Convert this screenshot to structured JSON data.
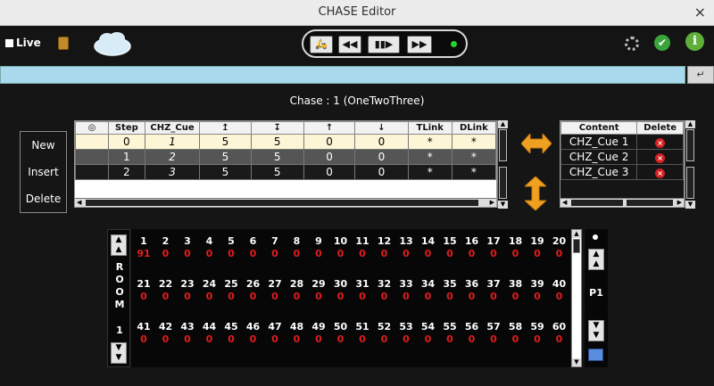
{
  "window": {
    "title": "CHASE Editor",
    "close_glyph": "×"
  },
  "toolbar": {
    "live_label": "Live",
    "transport": [
      {
        "name": "chase-mode-button",
        "glyph": "🛵"
      },
      {
        "name": "rewind-button",
        "glyph": "◀◀"
      },
      {
        "name": "step-play-button",
        "glyph": "▮▮▶"
      },
      {
        "name": "fast-forward-button",
        "glyph": "▶▶"
      }
    ],
    "check_glyph": "✔",
    "info_glyph": "i"
  },
  "command_line": {
    "value": "",
    "enter_glyph": "↵"
  },
  "chase": {
    "heading": "Chase : 1   (OneTwoThree)"
  },
  "side_buttons": {
    "new": "New",
    "insert": "Insert",
    "delete": "Delete"
  },
  "step_table": {
    "columns": [
      "◎",
      "Step",
      "CHZ_Cue",
      "↥",
      "↧",
      "↑",
      "↓",
      "TLink",
      "DLink"
    ],
    "rows": [
      [
        "",
        "0",
        "1",
        "5",
        "5",
        "0",
        "0",
        "*",
        "*"
      ],
      [
        "",
        "1",
        "2",
        "5",
        "5",
        "0",
        "0",
        "*",
        "*"
      ],
      [
        "",
        "2",
        "3",
        "5",
        "5",
        "0",
        "0",
        "*",
        "*"
      ]
    ]
  },
  "content_table": {
    "columns": [
      "Content",
      "Delete"
    ],
    "rows": [
      "CHZ_Cue 1",
      "CHZ_Cue 2",
      "CHZ_Cue 3"
    ]
  },
  "room": {
    "label_letters": [
      "R",
      "O",
      "O",
      "M"
    ],
    "number": "1",
    "page_label": "P1",
    "channels": [
      {
        "n": "1",
        "v": "91"
      },
      {
        "n": "2",
        "v": "0"
      },
      {
        "n": "3",
        "v": "0"
      },
      {
        "n": "4",
        "v": "0"
      },
      {
        "n": "5",
        "v": "0"
      },
      {
        "n": "6",
        "v": "0"
      },
      {
        "n": "7",
        "v": "0"
      },
      {
        "n": "8",
        "v": "0"
      },
      {
        "n": "9",
        "v": "0"
      },
      {
        "n": "10",
        "v": "0"
      },
      {
        "n": "11",
        "v": "0"
      },
      {
        "n": "12",
        "v": "0"
      },
      {
        "n": "13",
        "v": "0"
      },
      {
        "n": "14",
        "v": "0"
      },
      {
        "n": "15",
        "v": "0"
      },
      {
        "n": "16",
        "v": "0"
      },
      {
        "n": "17",
        "v": "0"
      },
      {
        "n": "18",
        "v": "0"
      },
      {
        "n": "19",
        "v": "0"
      },
      {
        "n": "20",
        "v": "0"
      },
      {
        "n": "21",
        "v": "0"
      },
      {
        "n": "22",
        "v": "0"
      },
      {
        "n": "23",
        "v": "0"
      },
      {
        "n": "24",
        "v": "0"
      },
      {
        "n": "25",
        "v": "0"
      },
      {
        "n": "26",
        "v": "0"
      },
      {
        "n": "27",
        "v": "0"
      },
      {
        "n": "28",
        "v": "0"
      },
      {
        "n": "29",
        "v": "0"
      },
      {
        "n": "30",
        "v": "0"
      },
      {
        "n": "31",
        "v": "0"
      },
      {
        "n": "32",
        "v": "0"
      },
      {
        "n": "33",
        "v": "0"
      },
      {
        "n": "34",
        "v": "0"
      },
      {
        "n": "35",
        "v": "0"
      },
      {
        "n": "36",
        "v": "0"
      },
      {
        "n": "37",
        "v": "0"
      },
      {
        "n": "38",
        "v": "0"
      },
      {
        "n": "39",
        "v": "0"
      },
      {
        "n": "40",
        "v": "0"
      },
      {
        "n": "41",
        "v": "0"
      },
      {
        "n": "42",
        "v": "0"
      },
      {
        "n": "43",
        "v": "0"
      },
      {
        "n": "44",
        "v": "0"
      },
      {
        "n": "45",
        "v": "0"
      },
      {
        "n": "46",
        "v": "0"
      },
      {
        "n": "47",
        "v": "0"
      },
      {
        "n": "48",
        "v": "0"
      },
      {
        "n": "49",
        "v": "0"
      },
      {
        "n": "50",
        "v": "0"
      },
      {
        "n": "51",
        "v": "0"
      },
      {
        "n": "52",
        "v": "0"
      },
      {
        "n": "53",
        "v": "0"
      },
      {
        "n": "54",
        "v": "0"
      },
      {
        "n": "55",
        "v": "0"
      },
      {
        "n": "56",
        "v": "0"
      },
      {
        "n": "57",
        "v": "0"
      },
      {
        "n": "58",
        "v": "0"
      },
      {
        "n": "59",
        "v": "0"
      },
      {
        "n": "60",
        "v": "0"
      }
    ]
  },
  "colors": {
    "command_bg": "#a9d9ec",
    "selected_row": "#fdf6d6",
    "channel_value": "#e21c1c",
    "arrow_orange": "#f0a020"
  }
}
